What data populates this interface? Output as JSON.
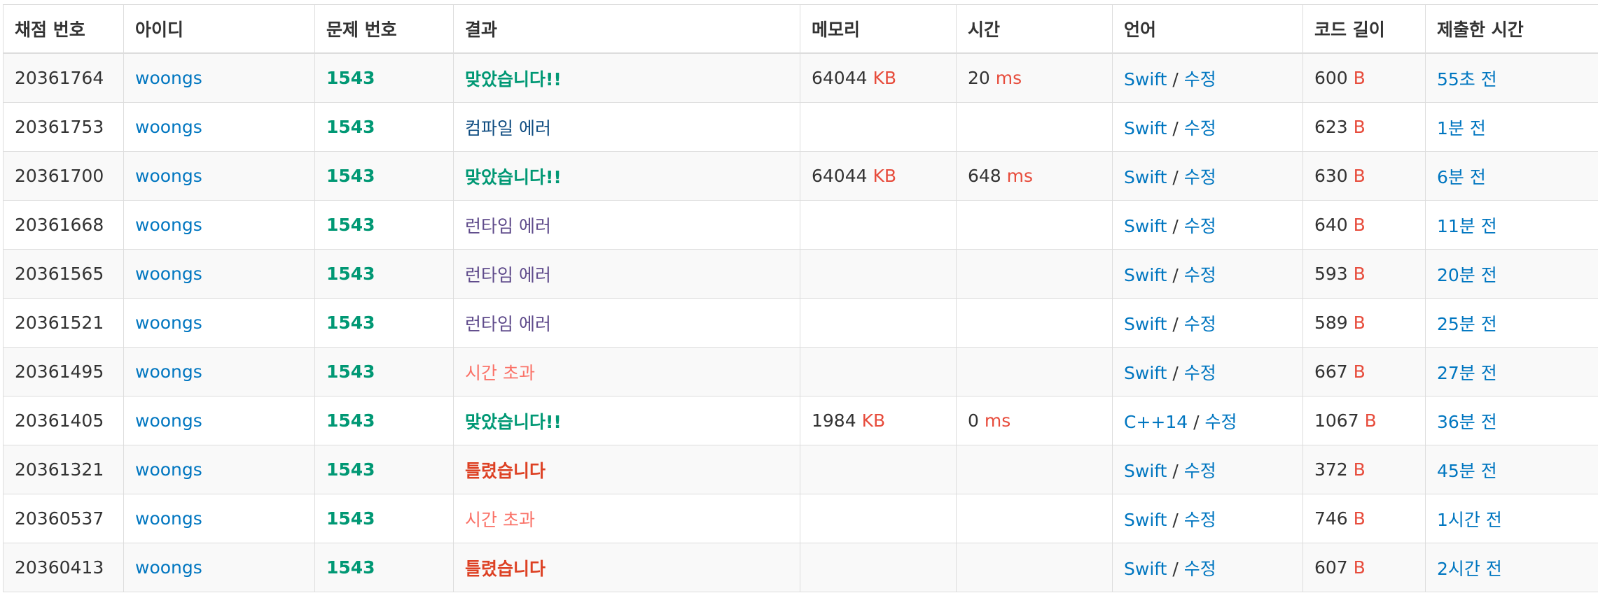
{
  "headers": {
    "submission_id": "채점 번호",
    "user_id": "아이디",
    "problem_id": "문제 번호",
    "result": "결과",
    "memory": "메모리",
    "time": "시간",
    "language": "언어",
    "code_length": "코드 길이",
    "submitted_at": "제출한 시간"
  },
  "units": {
    "memory": "KB",
    "time": "ms",
    "code_length": "B"
  },
  "edit_label": "수정",
  "separator": "/",
  "result_colors": {
    "ac": "#009874",
    "wa": "#dd4124",
    "rte": "#5f4b8b",
    "tle": "#fa7268",
    "ce": "#0f4c81",
    "link": "#0076c0",
    "unit": "#e74c3c"
  },
  "rows": [
    {
      "id": "20361764",
      "user": "woongs",
      "problem": "1543",
      "result": "맞았습니다!!",
      "result_type": "ac",
      "memory": "64044",
      "time": "20",
      "language": "Swift",
      "length": "600",
      "submitted": "55초 전"
    },
    {
      "id": "20361753",
      "user": "woongs",
      "problem": "1543",
      "result": "컴파일 에러",
      "result_type": "ce",
      "memory": "",
      "time": "",
      "language": "Swift",
      "length": "623",
      "submitted": "1분 전"
    },
    {
      "id": "20361700",
      "user": "woongs",
      "problem": "1543",
      "result": "맞았습니다!!",
      "result_type": "ac",
      "memory": "64044",
      "time": "648",
      "language": "Swift",
      "length": "630",
      "submitted": "6분 전"
    },
    {
      "id": "20361668",
      "user": "woongs",
      "problem": "1543",
      "result": "런타임 에러",
      "result_type": "rte",
      "memory": "",
      "time": "",
      "language": "Swift",
      "length": "640",
      "submitted": "11분 전"
    },
    {
      "id": "20361565",
      "user": "woongs",
      "problem": "1543",
      "result": "런타임 에러",
      "result_type": "rte",
      "memory": "",
      "time": "",
      "language": "Swift",
      "length": "593",
      "submitted": "20분 전"
    },
    {
      "id": "20361521",
      "user": "woongs",
      "problem": "1543",
      "result": "런타임 에러",
      "result_type": "rte",
      "memory": "",
      "time": "",
      "language": "Swift",
      "length": "589",
      "submitted": "25분 전"
    },
    {
      "id": "20361495",
      "user": "woongs",
      "problem": "1543",
      "result": "시간 초과",
      "result_type": "tle",
      "memory": "",
      "time": "",
      "language": "Swift",
      "length": "667",
      "submitted": "27분 전"
    },
    {
      "id": "20361405",
      "user": "woongs",
      "problem": "1543",
      "result": "맞았습니다!!",
      "result_type": "ac",
      "memory": "1984",
      "time": "0",
      "language": "C++14",
      "length": "1067",
      "submitted": "36분 전"
    },
    {
      "id": "20361321",
      "user": "woongs",
      "problem": "1543",
      "result": "틀렸습니다",
      "result_type": "wa",
      "memory": "",
      "time": "",
      "language": "Swift",
      "length": "372",
      "submitted": "45분 전"
    },
    {
      "id": "20360537",
      "user": "woongs",
      "problem": "1543",
      "result": "시간 초과",
      "result_type": "tle",
      "memory": "",
      "time": "",
      "language": "Swift",
      "length": "746",
      "submitted": "1시간 전"
    },
    {
      "id": "20360413",
      "user": "woongs",
      "problem": "1543",
      "result": "틀렸습니다",
      "result_type": "wa",
      "memory": "",
      "time": "",
      "language": "Swift",
      "length": "607",
      "submitted": "2시간 전"
    }
  ]
}
